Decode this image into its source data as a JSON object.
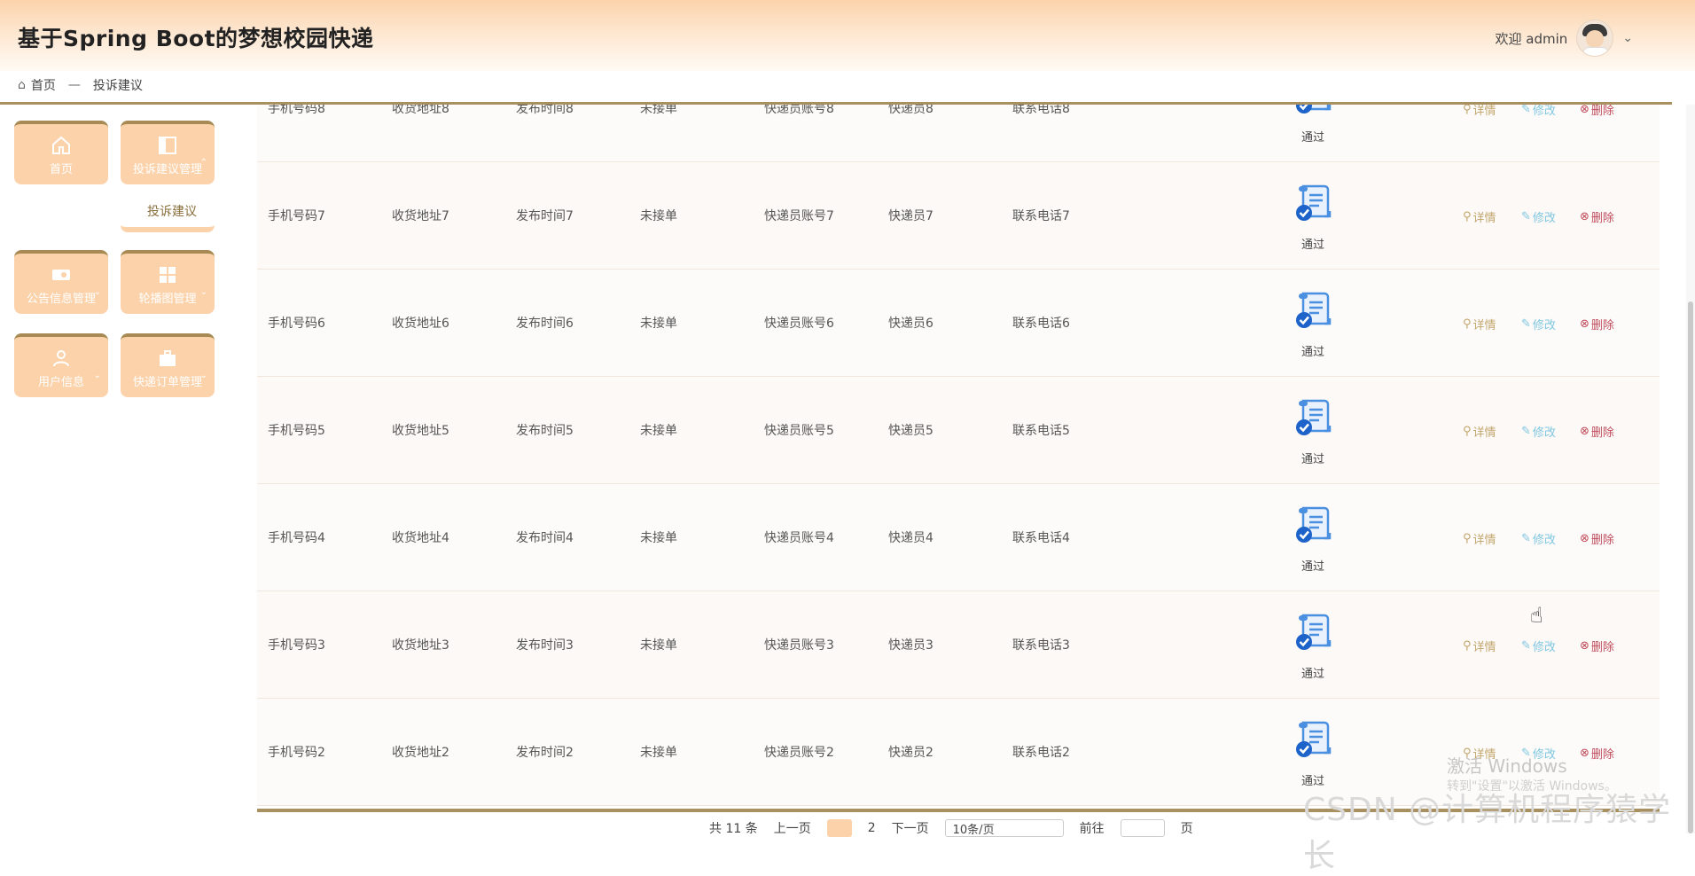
{
  "header": {
    "title": "基于Spring Boot的梦想校园快递",
    "welcome": "欢迎 admin",
    "dropdown_icon": "chevron-down-icon"
  },
  "breadcrumb": {
    "home": "首页",
    "separator": "—",
    "current": "投诉建议"
  },
  "sidebar": {
    "items": [
      {
        "label": "首页",
        "icon": "home-icon"
      },
      {
        "label": "投诉建议管理",
        "icon": "panel-icon"
      },
      {
        "label": "公告信息管理",
        "icon": "toggle-icon"
      },
      {
        "label": "轮播图管理",
        "icon": "grid-icon"
      },
      {
        "label": "用户信息",
        "icon": "user-icon"
      },
      {
        "label": "快递订单管理",
        "icon": "briefcase-icon"
      }
    ],
    "submenu_label": "投诉建议"
  },
  "table": {
    "rows": [
      {
        "phone": "手机号码8",
        "address": "收货地址8",
        "time": "发布时间8",
        "status": "未接单",
        "courier_account": "快递员账号8",
        "courier": "快递员8",
        "contact": "联系电话8",
        "audit": "通过"
      },
      {
        "phone": "手机号码7",
        "address": "收货地址7",
        "time": "发布时间7",
        "status": "未接单",
        "courier_account": "快递员账号7",
        "courier": "快递员7",
        "contact": "联系电话7",
        "audit": "通过"
      },
      {
        "phone": "手机号码6",
        "address": "收货地址6",
        "time": "发布时间6",
        "status": "未接单",
        "courier_account": "快递员账号6",
        "courier": "快递员6",
        "contact": "联系电话6",
        "audit": "通过"
      },
      {
        "phone": "手机号码5",
        "address": "收货地址5",
        "time": "发布时间5",
        "status": "未接单",
        "courier_account": "快递员账号5",
        "courier": "快递员5",
        "contact": "联系电话5",
        "audit": "通过"
      },
      {
        "phone": "手机号码4",
        "address": "收货地址4",
        "time": "发布时间4",
        "status": "未接单",
        "courier_account": "快递员账号4",
        "courier": "快递员4",
        "contact": "联系电话4",
        "audit": "通过"
      },
      {
        "phone": "手机号码3",
        "address": "收货地址3",
        "time": "发布时间3",
        "status": "未接单",
        "courier_account": "快递员账号3",
        "courier": "快递员3",
        "contact": "联系电话3",
        "audit": "通过"
      },
      {
        "phone": "手机号码2",
        "address": "收货地址2",
        "time": "发布时间2",
        "status": "未接单",
        "courier_account": "快递员账号2",
        "courier": "快递员2",
        "contact": "联系电话2",
        "audit": "通过"
      }
    ],
    "actions": {
      "detail": "详情",
      "edit": "修改",
      "delete": "删除"
    }
  },
  "pagination": {
    "total": "共 11 条",
    "prev": "上一页",
    "page1": "1",
    "page2": "2",
    "next": "下一页",
    "page_size": "10条/页",
    "goto": "前往",
    "page_unit": "页"
  },
  "watermark": {
    "activate": "激活 Windows",
    "activate_hint": "转到\"设置\"以激活 Windows。",
    "csdn": "CSDN @计算机程序猿学长"
  },
  "colors": {
    "header_gradient_top": "#fbd3ab",
    "tile_bg": "#fcd2aa",
    "tile_border": "#a88a55",
    "detail": "#c2a56b",
    "edit": "#7fc7e0",
    "delete": "#c04b5b",
    "doc_icon": "#4a8fe0"
  }
}
